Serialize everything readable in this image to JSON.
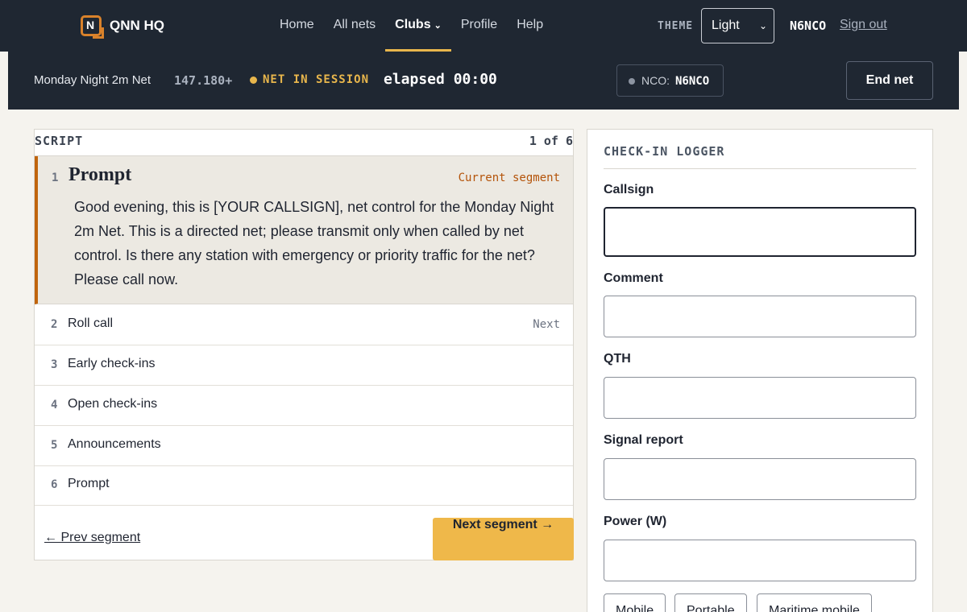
{
  "nav": {
    "brand": "QNN HQ",
    "logo_glyph": "N",
    "links": [
      {
        "label": "Home"
      },
      {
        "label": "All nets"
      },
      {
        "label": "Clubs",
        "active": true,
        "caret": "⌄"
      },
      {
        "label": "Profile"
      },
      {
        "label": "Help"
      }
    ],
    "theme_label": "THEME",
    "theme_value": "Light",
    "theme_chevron": "⌄",
    "callsign": "N6NCO",
    "signout": "Sign out"
  },
  "status": {
    "net_name": "Monday Night 2m Net",
    "frequency": "147.180+",
    "session": "NET IN SESSION",
    "elapsed": "elapsed 00:00",
    "nco_label": "NCO:",
    "nco_call": "N6NCO",
    "end_net": "End net"
  },
  "script": {
    "title": "SCRIPT",
    "count": "1 of 6",
    "current": {
      "num": "1",
      "title": "Prompt",
      "badge": "Current segment",
      "body": "Good evening, this is [YOUR CALLSIGN], net control for the Monday Night 2m Net. This is a directed net; please transmit only when called by net control. Is there any station with emergency or priority traffic for the net? Please call now."
    },
    "segments": [
      {
        "num": "2",
        "title": "Roll call",
        "badge": "Next"
      },
      {
        "num": "3",
        "title": "Early check-ins",
        "badge": ""
      },
      {
        "num": "4",
        "title": "Open check-ins",
        "badge": ""
      },
      {
        "num": "5",
        "title": "Announcements",
        "badge": ""
      },
      {
        "num": "6",
        "title": "Prompt",
        "badge": ""
      }
    ],
    "prev": "← Prev segment",
    "next": "Next segment →"
  },
  "logger": {
    "title": "CHECK-IN LOGGER",
    "fields": [
      {
        "label": "Callsign",
        "value": ""
      },
      {
        "label": "Comment",
        "value": ""
      },
      {
        "label": "QTH",
        "value": ""
      },
      {
        "label": "Signal report",
        "value": ""
      },
      {
        "label": "Power (W)",
        "value": ""
      }
    ],
    "chips": [
      "Mobile",
      "Portable",
      "Maritime mobile"
    ]
  },
  "colors": {
    "nav_bg": "#1f2732",
    "accent": "#e8b64c",
    "current_border": "#c0640c"
  },
  "icons": {
    "logo": "qnn-logo-icon",
    "status_dot": "status-dot-icon",
    "nco_dot": "nco-dot-icon"
  }
}
